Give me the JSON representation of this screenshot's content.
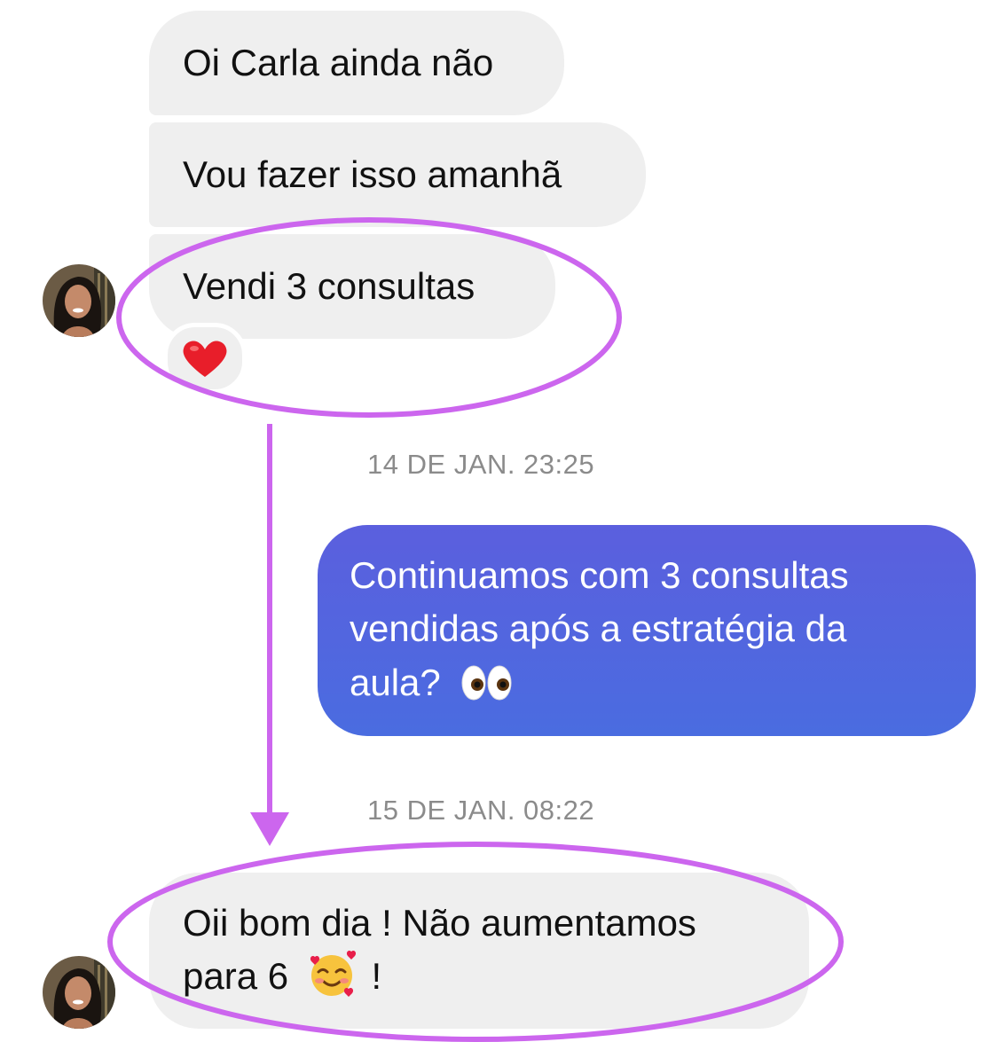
{
  "messages": [
    {
      "text": "Oi Carla ainda não"
    },
    {
      "text": "Vou fazer isso amanhã"
    },
    {
      "text": "Vendi 3 consultas",
      "reaction": "heart"
    },
    {
      "text_line1": "Continuamos com 3 consultas",
      "text_line2": "vendidas após a estratégia da",
      "text_line3": "aula?",
      "emoji": "eyes"
    },
    {
      "text_line1": "Oii bom dia ! Não aumentamos",
      "text_line2_a": "para 6",
      "text_line2_b": "!",
      "emoji": "smiling-face-with-hearts"
    }
  ],
  "timestamps": {
    "first": "14 DE JAN. 23:25",
    "second": "15 DE JAN. 08:22"
  },
  "colors": {
    "incoming_bubble": "#efefef",
    "outgoing_gradient_top": "#5b5fde",
    "outgoing_gradient_bottom": "#4a6ce0",
    "annotation": "#cc66ee",
    "timestamp": "#8b8b8b"
  }
}
